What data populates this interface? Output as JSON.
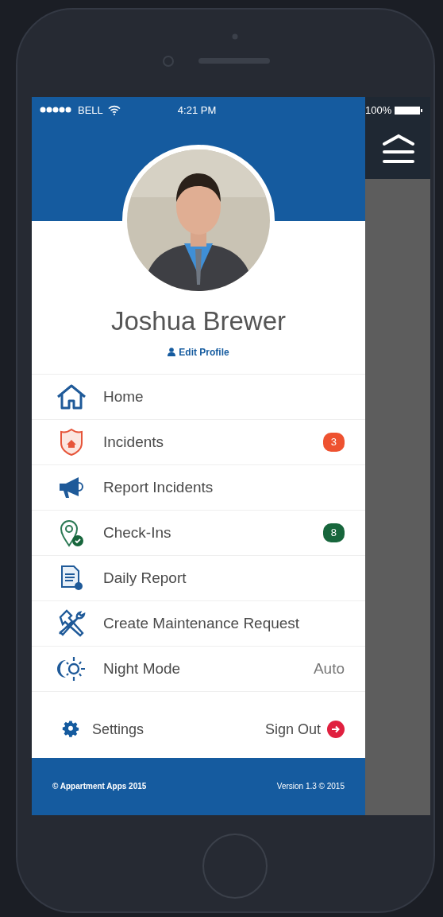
{
  "status_bar": {
    "carrier": "BELL",
    "time": "4:21 PM",
    "battery": "100%"
  },
  "profile": {
    "name": "Joshua Brewer",
    "edit_link": "Edit Profile"
  },
  "menu": [
    {
      "label": "Home"
    },
    {
      "label": "Incidents",
      "badge": "3",
      "color": "#ee5230"
    },
    {
      "label": "Report Incidents"
    },
    {
      "label": "Check-Ins",
      "badge": "8",
      "color": "#17663c"
    },
    {
      "label": "Daily Report"
    },
    {
      "label": "Create Maintenance Request"
    },
    {
      "label": "Night Mode",
      "value": "Auto"
    }
  ],
  "bottom": {
    "settings": "Settings",
    "sign_out": "Sign Out"
  },
  "footer": {
    "copyright": "© Appartment Apps 2015",
    "version": "Version 1.3 © 2015"
  }
}
